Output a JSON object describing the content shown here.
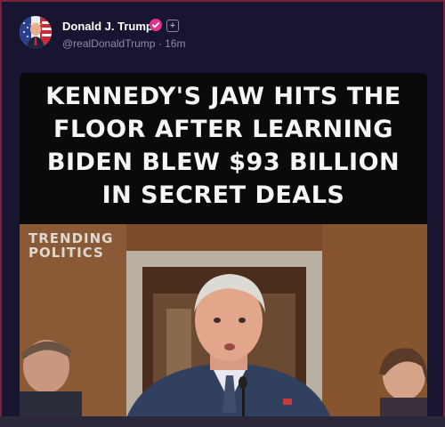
{
  "post": {
    "author_name": "Donald J. Trump",
    "author_handle": "@realDonaldTrump · 16m",
    "headline": [
      "KENNEDY'S JAW HITS THE",
      "FLOOR AFTER LEARNING",
      "BIDEN BLEW $93 BILLION",
      "IN SECRET DEALS"
    ],
    "watermark": [
      "TRENDING",
      "POLITICS"
    ]
  },
  "icons": {
    "verified": "verified-badge-icon",
    "follow": "plus-icon"
  },
  "colors": {
    "frame_border": "#7a1f3d",
    "background": "#181530",
    "verified_badge": "#e0338d",
    "headline_bg": "#0a0a0a"
  }
}
